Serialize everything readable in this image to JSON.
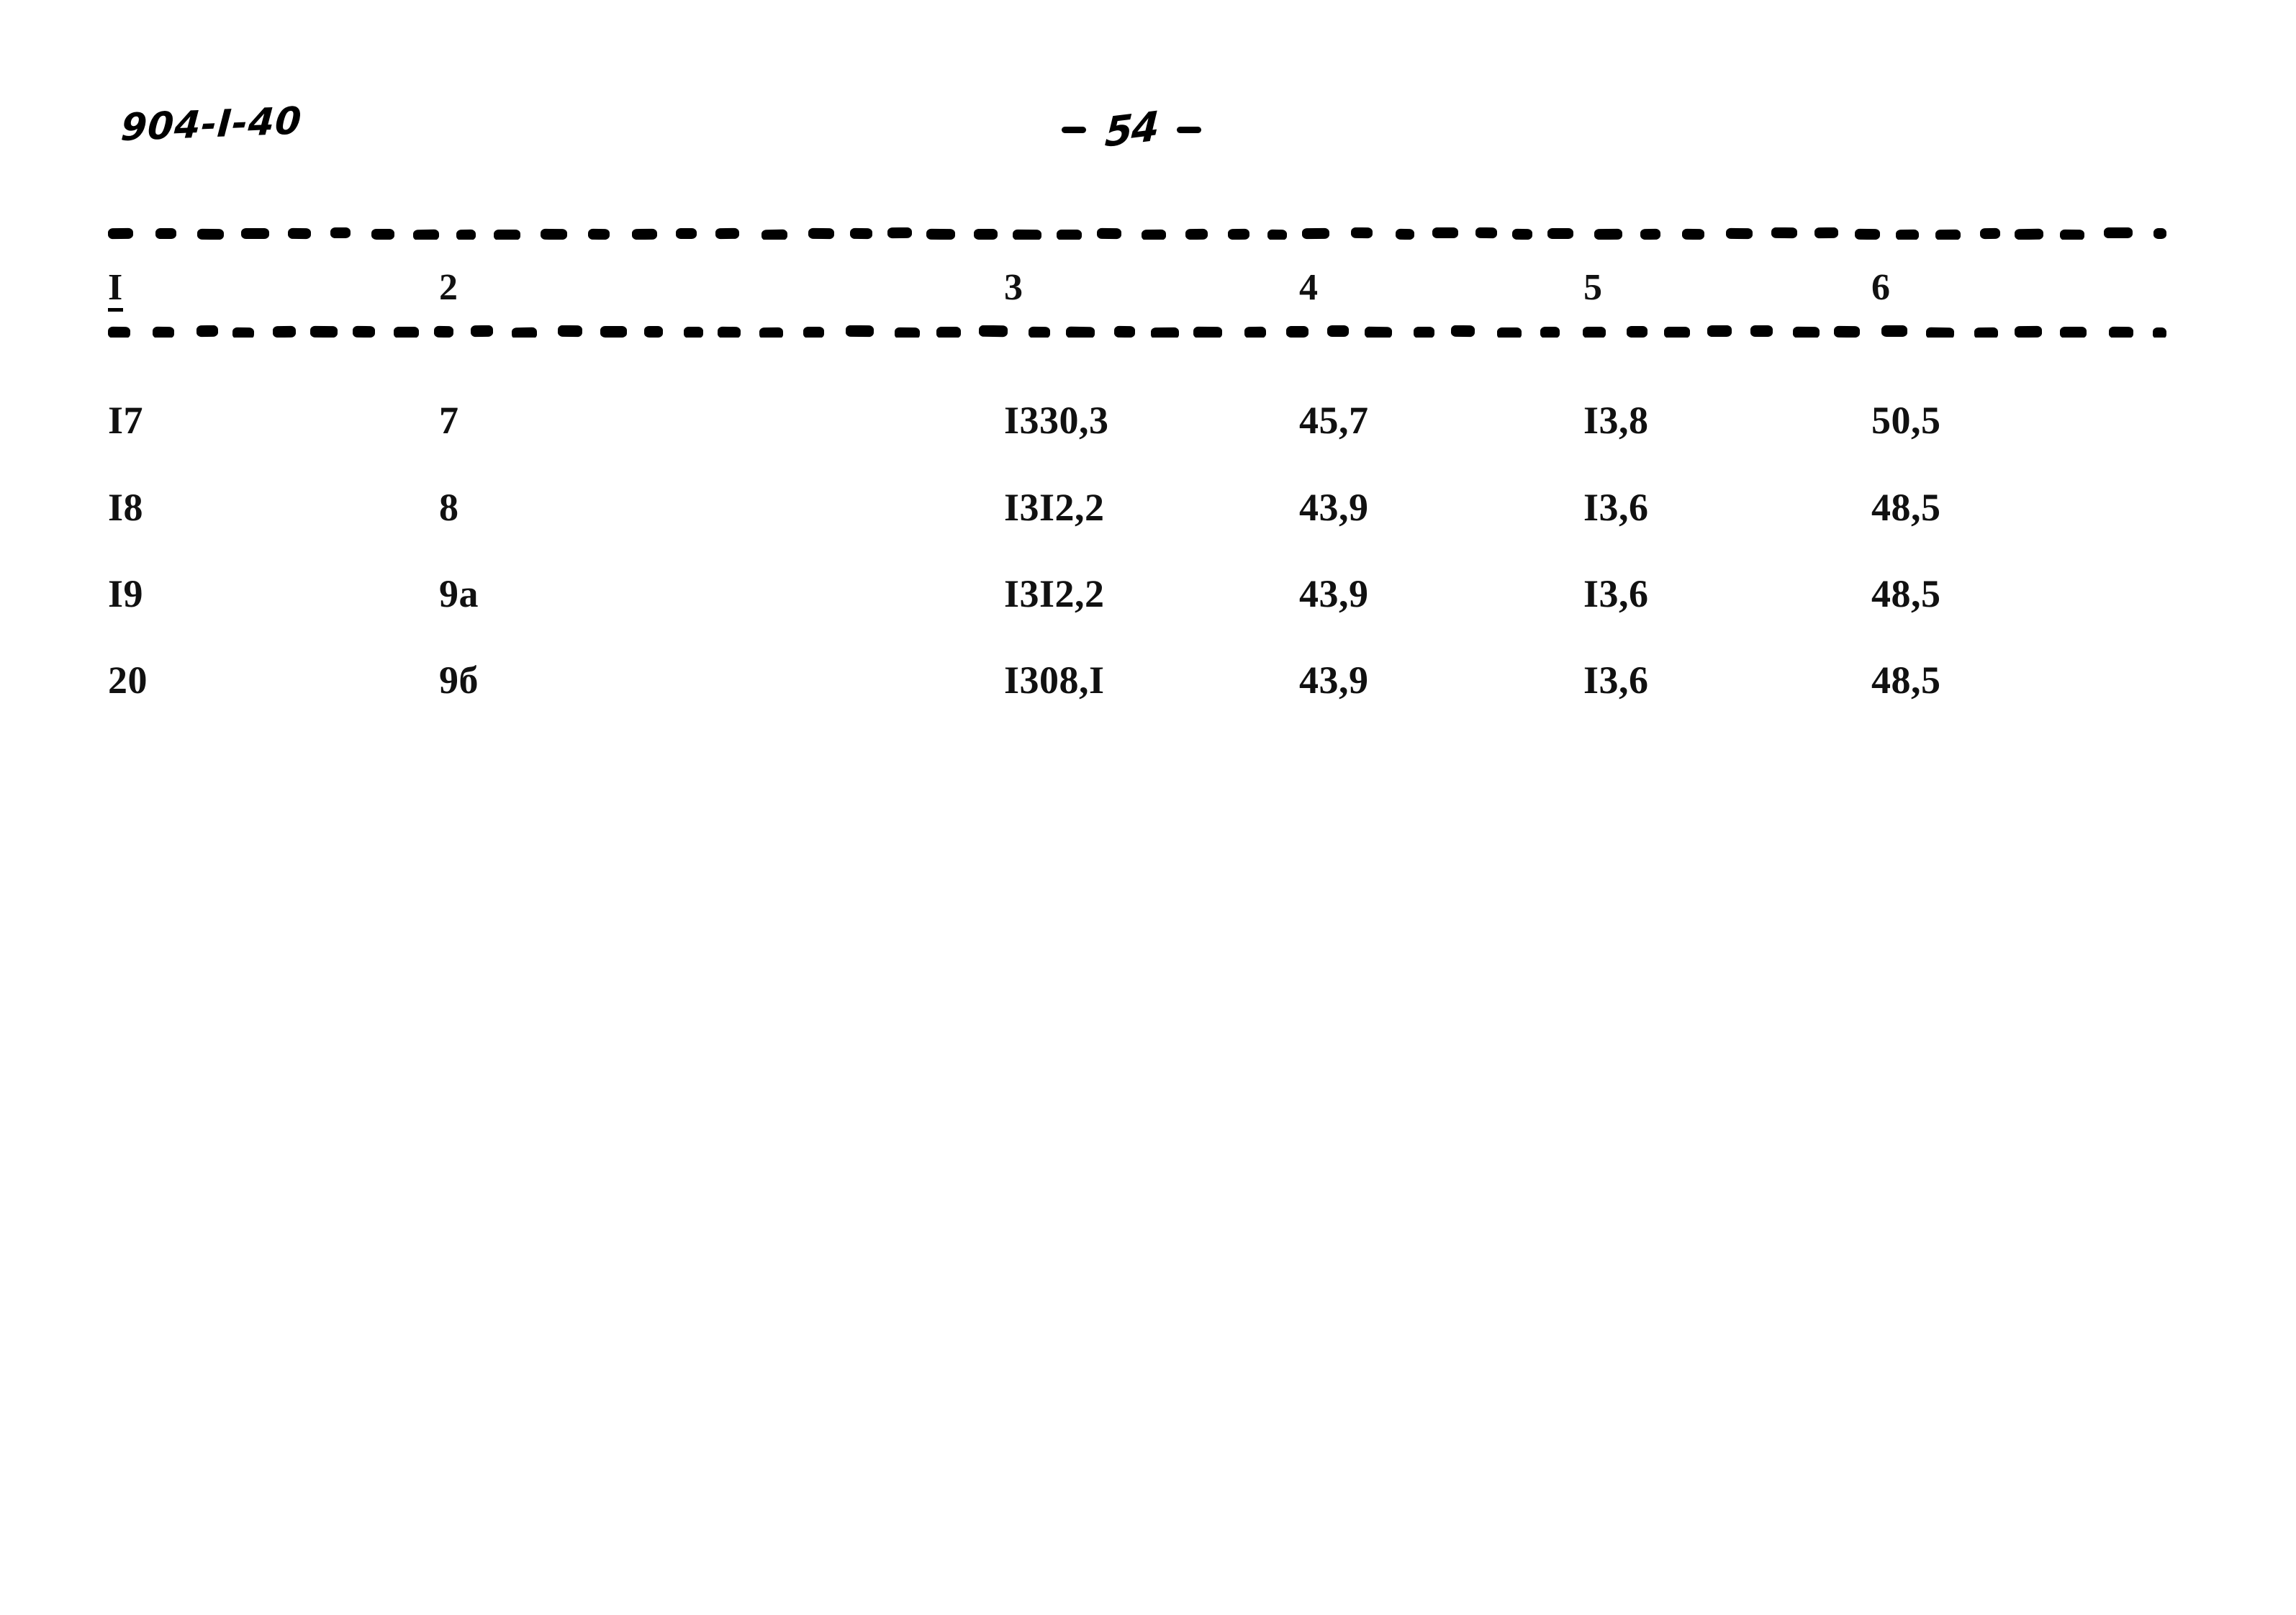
{
  "page": {
    "doc_code": "904-I-40",
    "page_number": "54",
    "page_number_left_dash": "-",
    "page_number_right_dash": "-",
    "background_color": "#ffffff",
    "ink_color": "#111111"
  },
  "table": {
    "column_headers": [
      "I",
      "2",
      "3",
      "4",
      "5",
      "6"
    ],
    "rows": [
      {
        "c1": "I7",
        "c2": "7",
        "c3": "I330,3",
        "c4": "45,7",
        "c5": "I3,8",
        "c6": "50,5"
      },
      {
        "c1": "I8",
        "c2": "8",
        "c3": "I3I2,2",
        "c4": "43,9",
        "c5": "I3,6",
        "c6": "48,5"
      },
      {
        "c1": "I9",
        "c2": "9a",
        "c3": "I3I2,2",
        "c4": "43,9",
        "c5": "I3,6",
        "c6": "48,5"
      },
      {
        "c1": "20",
        "c2": "9б",
        "c3": "I308,I",
        "c4": "43,9",
        "c5": "I3,6",
        "c6": "48,5"
      }
    ]
  },
  "rules": {
    "top_label": "dashed-rule-top",
    "bottom_label": "dashed-rule-bottom"
  }
}
